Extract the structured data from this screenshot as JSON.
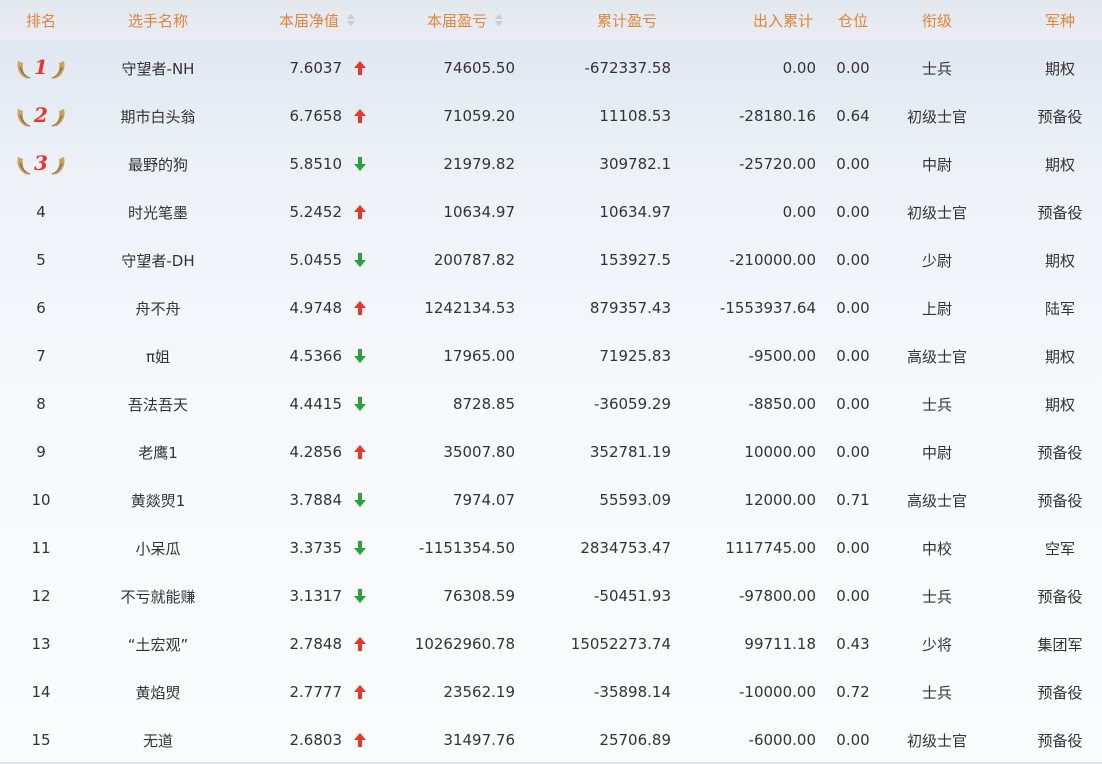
{
  "header": {
    "rank": "排名",
    "name": "选手名称",
    "net_value": "本届净值",
    "profit": "本届盈亏",
    "cumulative": "累计盈亏",
    "inout": "出入累计",
    "position": "仓位",
    "title": "衔级",
    "arm": "军种"
  },
  "colors": {
    "header_text": "#e0853a",
    "up": "#e8362d",
    "down": "#2aa13c"
  },
  "rows": [
    {
      "rank": "1",
      "medal": true,
      "name": "守望者-NH",
      "nv": "7.6037",
      "dir": "up",
      "pl": "74605.50",
      "cum": "-672337.58",
      "io": "0.00",
      "pos": "0.00",
      "title": "士兵",
      "arm": "期权"
    },
    {
      "rank": "2",
      "medal": true,
      "name": "期市白头翁",
      "nv": "6.7658",
      "dir": "up",
      "pl": "71059.20",
      "cum": "11108.53",
      "io": "-28180.16",
      "pos": "0.64",
      "title": "初级士官",
      "arm": "预备役"
    },
    {
      "rank": "3",
      "medal": true,
      "name": "最野的狗",
      "nv": "5.8510",
      "dir": "down",
      "pl": "21979.82",
      "cum": "309782.1",
      "io": "-25720.00",
      "pos": "0.00",
      "title": "中尉",
      "arm": "期权"
    },
    {
      "rank": "4",
      "medal": false,
      "name": "时光笔墨",
      "nv": "5.2452",
      "dir": "up",
      "pl": "10634.97",
      "cum": "10634.97",
      "io": "0.00",
      "pos": "0.00",
      "title": "初级士官",
      "arm": "预备役"
    },
    {
      "rank": "5",
      "medal": false,
      "name": "守望者-DH",
      "nv": "5.0455",
      "dir": "down",
      "pl": "200787.82",
      "cum": "153927.5",
      "io": "-210000.00",
      "pos": "0.00",
      "title": "少尉",
      "arm": "期权"
    },
    {
      "rank": "6",
      "medal": false,
      "name": "舟不舟",
      "nv": "4.9748",
      "dir": "up",
      "pl": "1242134.53",
      "cum": "879357.43",
      "io": "-1553937.64",
      "pos": "0.00",
      "title": "上尉",
      "arm": "陆军"
    },
    {
      "rank": "7",
      "medal": false,
      "name": "π姐",
      "nv": "4.5366",
      "dir": "down",
      "pl": "17965.00",
      "cum": "71925.83",
      "io": "-9500.00",
      "pos": "0.00",
      "title": "高级士官",
      "arm": "期权"
    },
    {
      "rank": "8",
      "medal": false,
      "name": "吾法吾天",
      "nv": "4.4415",
      "dir": "down",
      "pl": "8728.85",
      "cum": "-36059.29",
      "io": "-8850.00",
      "pos": "0.00",
      "title": "士兵",
      "arm": "期权"
    },
    {
      "rank": "9",
      "medal": false,
      "name": "老鹰1",
      "nv": "4.2856",
      "dir": "up",
      "pl": "35007.80",
      "cum": "352781.19",
      "io": "10000.00",
      "pos": "0.00",
      "title": "中尉",
      "arm": "预备役"
    },
    {
      "rank": "10",
      "medal": false,
      "name": "黄燚焽1",
      "nv": "3.7884",
      "dir": "down",
      "pl": "7974.07",
      "cum": "55593.09",
      "io": "12000.00",
      "pos": "0.71",
      "title": "高级士官",
      "arm": "预备役"
    },
    {
      "rank": "11",
      "medal": false,
      "name": "小呆瓜",
      "nv": "3.3735",
      "dir": "down",
      "pl": "-1151354.50",
      "cum": "2834753.47",
      "io": "1117745.00",
      "pos": "0.00",
      "title": "中校",
      "arm": "空军"
    },
    {
      "rank": "12",
      "medal": false,
      "name": "不亏就能赚",
      "nv": "3.1317",
      "dir": "down",
      "pl": "76308.59",
      "cum": "-50451.93",
      "io": "-97800.00",
      "pos": "0.00",
      "title": "士兵",
      "arm": "预备役"
    },
    {
      "rank": "13",
      "medal": false,
      "name": "“土宏观”",
      "nv": "2.7848",
      "dir": "up",
      "pl": "10262960.78",
      "cum": "15052273.74",
      "io": "99711.18",
      "pos": "0.43",
      "title": "少将",
      "arm": "集团军"
    },
    {
      "rank": "14",
      "medal": false,
      "name": "黄焰焽",
      "nv": "2.7777",
      "dir": "up",
      "pl": "23562.19",
      "cum": "-35898.14",
      "io": "-10000.00",
      "pos": "0.72",
      "title": "士兵",
      "arm": "预备役"
    },
    {
      "rank": "15",
      "medal": false,
      "name": "无道",
      "nv": "2.6803",
      "dir": "up",
      "pl": "31497.76",
      "cum": "25706.89",
      "io": "-6000.00",
      "pos": "0.00",
      "title": "初级士官",
      "arm": "预备役"
    }
  ]
}
